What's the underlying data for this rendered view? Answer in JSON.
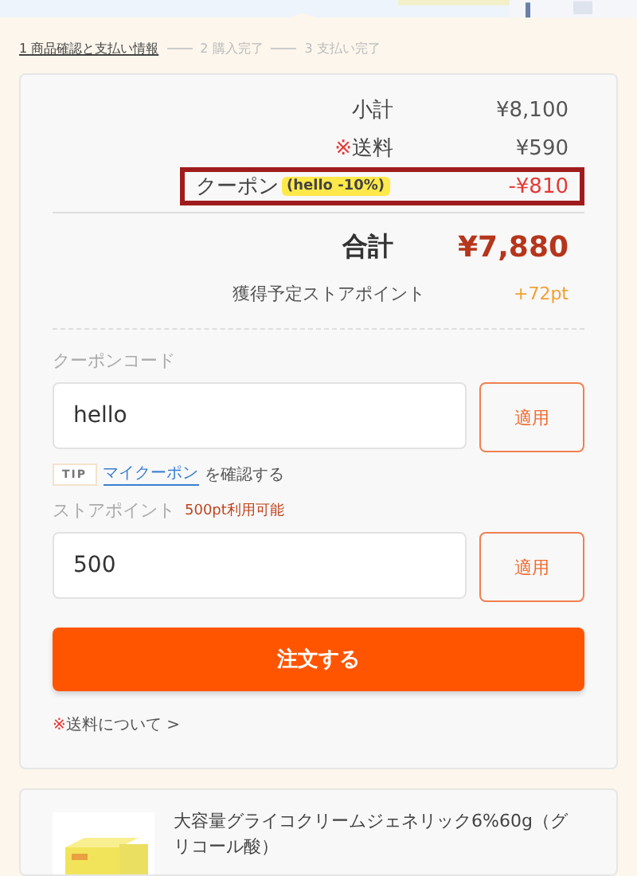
{
  "steps": [
    {
      "label": "1 商品確認と支払い情報",
      "selected": true
    },
    {
      "label": "2 購入完了",
      "selected": false
    },
    {
      "label": "3 支払い完了",
      "selected": false
    }
  ],
  "summary": [
    {
      "kind": "plain",
      "label": "小計",
      "value": "¥8,100"
    },
    {
      "kind": "noted",
      "mark": "※",
      "label": "送料",
      "value": "¥590"
    },
    {
      "kind": "coupon",
      "label": "クーポン",
      "badge": "(hello -10%)",
      "value": "-¥810",
      "highlighted": true
    }
  ],
  "total": {
    "label": "合計",
    "value": "¥7,880"
  },
  "points_earned": {
    "label": "獲得予定ストアポイント",
    "value": "+72pt"
  },
  "coupon": {
    "label": "クーポンコード",
    "value": "hello",
    "button": "適用"
  },
  "tip": {
    "tag": "TIP",
    "link": "マイクーポン",
    "text": "を確認する"
  },
  "store_points": {
    "label": "ストアポイント",
    "available": "500pt利用可能",
    "value": "500",
    "button": "適用"
  },
  "order_button": "注文する",
  "shipping_link": {
    "mark": "※",
    "text": "送料について >"
  },
  "product": {
    "title": "大容量グライコクリームジェネリック6%60g（グリコール酸）"
  }
}
